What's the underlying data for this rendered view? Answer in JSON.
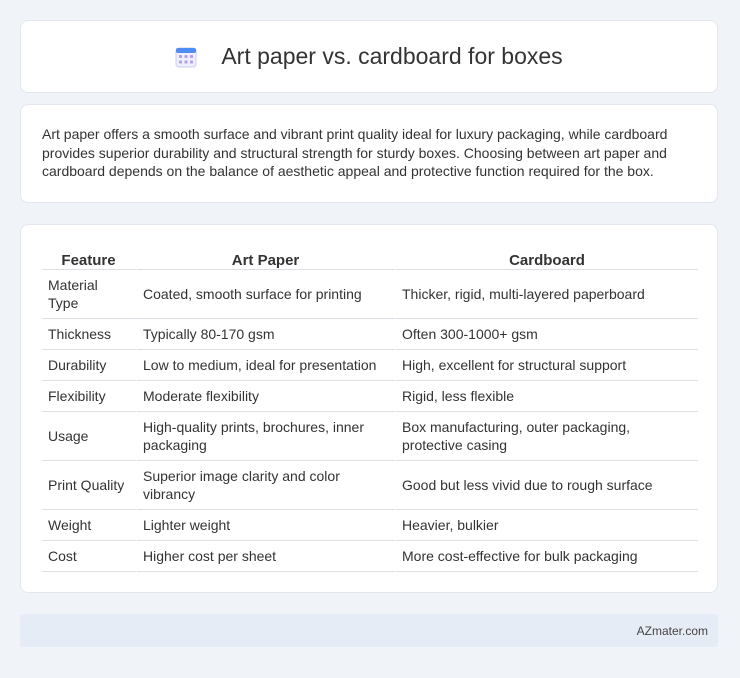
{
  "header": {
    "title": "Art paper vs. cardboard for boxes",
    "icon": "calendar-icon"
  },
  "intro": {
    "text": "Art paper offers a smooth surface and vibrant print quality ideal for luxury packaging, while cardboard provides superior durability and structural strength for sturdy boxes. Choosing between art paper and cardboard depends on the balance of aesthetic appeal and protective function required for the box."
  },
  "table": {
    "headers": [
      "Feature",
      "Art Paper",
      "Cardboard"
    ],
    "rows": [
      [
        "Material Type",
        "Coated, smooth surface for printing",
        "Thicker, rigid, multi-layered paperboard"
      ],
      [
        "Thickness",
        "Typically 80-170 gsm",
        "Often 300-1000+ gsm"
      ],
      [
        "Durability",
        "Low to medium, ideal for presentation",
        "High, excellent for structural support"
      ],
      [
        "Flexibility",
        "Moderate flexibility",
        "Rigid, less flexible"
      ],
      [
        "Usage",
        "High-quality prints, brochures, inner packaging",
        "Box manufacturing, outer packaging, protective casing"
      ],
      [
        "Print Quality",
        "Superior image clarity and color vibrancy",
        "Good but less vivid due to rough surface"
      ],
      [
        "Weight",
        "Lighter weight",
        "Heavier, bulkier"
      ],
      [
        "Cost",
        "Higher cost per sheet",
        "More cost-effective for bulk packaging"
      ]
    ]
  },
  "footer": {
    "brand": "AZmater.com"
  }
}
